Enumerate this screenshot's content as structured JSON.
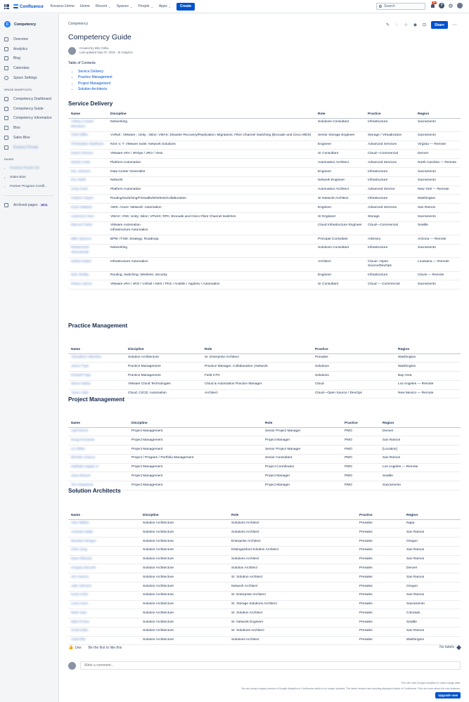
{
  "topnav": {
    "product": "Confluence",
    "items": [
      "Kovarus Home",
      "Home",
      "Recent",
      "Spaces",
      "People",
      "Apps"
    ],
    "dropdown_items": [
      "Recent",
      "Spaces",
      "People",
      "Apps"
    ],
    "create_label": "Create",
    "search_placeholder": "Search",
    "notifications_count": "9+"
  },
  "sidebar": {
    "space_name": "Competency",
    "nav": [
      "Overview",
      "Analytics",
      "Blog",
      "Calendars",
      "Space Settings"
    ],
    "shortcuts_heading": "SPACE SHORTCUTS",
    "shortcuts": [
      "Competency Dashboard",
      "Competency Guide",
      "Competency Information",
      "Bios",
      "Sales Bios",
      "Kovarus Private"
    ],
    "pages_heading": "PAGES",
    "pages": [
      "Kovarus Private Lib",
      "Sales Bios",
      "Partner Program Certifi..."
    ],
    "archived_label": "Archived pages",
    "beta_label": "BETA"
  },
  "page": {
    "breadcrumb": "Competency",
    "share_label": "Share",
    "title": "Competency Guide",
    "created_by": "Created by Milo Grilka",
    "last_updated": "Last updated May 07, 2019",
    "analytics_label": "Analytics",
    "toc_title": "Table of Contents",
    "toc": [
      "Service Delivery",
      "Practice Management",
      "Project Management",
      "Solution Architects"
    ]
  },
  "service_delivery": {
    "heading": "Service Delivery",
    "columns": [
      "Name",
      "Discipline",
      "Role",
      "Practice",
      "Region"
    ],
    "rows": [
      [
        "Ashley Conrad Mendoza",
        "Networking",
        "Solutions Consultant",
        "Infrastructure",
        "Sacramento"
      ],
      [
        "Chris Miller",
        "VxRail ; VMware ; Unity ; Isilon; VMAX; Disaster Recovery/Replication; Migrations; Fibre Channel Switching (Brocade and Cisco MDS)",
        "Senior Storage Engineer",
        "Storage / Virtualization",
        "Sacramento"
      ],
      [
        "Christopher Matthews",
        "NSX V, T: VMware Suite: Network Solutions",
        "Engineer",
        "Advanced Services",
        "Virginia — Remote"
      ],
      [
        "David Johnson",
        "VMware vRA / vROps / vRO / View",
        "Sr Consultant",
        "Cloud—Commercial",
        "Denver"
      ],
      [
        "Daniel Lewis",
        "Platform Automation",
        "Automation Architect",
        "Advanced Services",
        "North Carolina — Remote"
      ],
      [
        "Eric Johnson",
        "Data Center Generalist",
        "Engineer",
        "Infrastructure",
        "Sacramento"
      ],
      [
        "Eric Wells",
        "Network",
        "Network Engineer",
        "Infrastructure",
        "Sacramento"
      ],
      [
        "Greg Grant",
        "Platform Automation",
        "Automation Architect",
        "Advanced Service",
        "New York — Remote"
      ],
      [
        "Hudson Hayes",
        "Routing/Switching/Firewalls/Wireless/Collaboration",
        "Sr Network Architect",
        "Infrastructure",
        "Washington"
      ],
      [
        "Kevin Madsen",
        "AWS: Azure: Network: Automation",
        "Engineer",
        "Advanced Services",
        "San Ramon"
      ],
      [
        "Lawrence Hunt",
        "VMAX; VNX; Unity; Isilon; VPLEX; RPA; Brocade and Cisco Fibre Channel switches",
        "Sr Engineer",
        "Storage",
        "Sacramento"
      ],
      [
        "Marcus Foster",
        "VMware Automation\nInfrastructure Automation",
        "Cloud Infrastructure Engineer",
        "Cloud—Commercial",
        "Seattle"
      ],
      [
        "Mike Spencer",
        "BPM; ITSM; Strategy; Roadmap",
        "Principal Consultant",
        "Advisory",
        "Arizona — Remote"
      ],
      [
        "Mohammed Abouzeinab",
        "Networking",
        "Solutions Consultant",
        "Infrastructure",
        "Sacramento"
      ],
      [
        "Nathan Baker",
        "Infrastructure Automation",
        "Architect",
        "Cloud—Open Source/DevOps",
        "Louisiana — Remote"
      ],
      [
        "Nick Shelby",
        "Routing; Switching; Wireless; Security",
        "Engineer",
        "Infrastructure",
        "Clovis — Remote"
      ],
      [
        "Robert James",
        "VMware vRA / vRO / VxRail / AWS / PKS / Ansible / AppDev / Automation",
        "Sr Consultant",
        "Cloud — Commercial",
        "Sacramento"
      ]
    ]
  },
  "practice_management": {
    "heading": "Practice Management",
    "columns": [
      "Name",
      "Discipline",
      "Role",
      "Practice",
      "Region"
    ],
    "rows": [
      [
        "Johnathon Valentine",
        "Solution Architecture",
        "Sr. Enterprise Architect",
        "Presales",
        "Washington"
      ],
      [
        "Jason Pope",
        "Practice Management",
        "Practice Manager, Collaboration | Network",
        "Solutions",
        "Washington"
      ],
      [
        "Russell Fripp",
        "Practice Management",
        "Field CTO",
        "Solutions",
        "Bay Area"
      ],
      [
        "Steve Harlan",
        "VMware Cloud Technologies",
        "Cloud & Automation Practice Manager",
        "Cloud",
        "Los Angeles — Remote"
      ],
      [
        "Tyson Adair",
        "Cloud; CI/CD; Automation",
        "Architect",
        "Cloud—Open Source / DevOps",
        "New Mexico — Remote"
      ]
    ]
  },
  "project_management": {
    "heading": "Project Management",
    "columns": [
      "Name",
      "Discipline",
      "Role",
      "Practice",
      "Region"
    ],
    "rows": [
      [
        "April Morris",
        "Project Management",
        "Senior Project Manager",
        "PMO",
        "Denver"
      ],
      [
        "Doug Fernando",
        "Project Management",
        "Project Manager",
        "PMO",
        "San Ramon"
      ],
      [
        "Liz White",
        "Project Management",
        "Senior Project Manager",
        "PMO",
        "[Location]"
      ],
      [
        "Michele Chance",
        "Project / Program / Portfolio Management",
        "Senior Consultant",
        "PMO",
        "San Ramon"
      ],
      [
        "Nathalie Kappel Jr",
        "Project Management",
        "Project Coordinator",
        "PMO",
        "Los Angeles — Remote"
      ],
      [
        "Sara Weaver",
        "Project Management",
        "Project Manager",
        "PMO",
        "Seattle"
      ],
      [
        "Tim Kirkpatrick",
        "Project Management",
        "Project Manager",
        "PMO",
        "Sacramento"
      ]
    ]
  },
  "solution_architects": {
    "heading": "Solution Architects",
    "columns": [
      "Name",
      "Discipline",
      "Role",
      "Practice",
      "Region"
    ],
    "rows": [
      [
        "Alan Walton",
        "Solution Architecture",
        "Solutions Architect",
        "Presales",
        "Napa"
      ],
      [
        "Amanda Watts",
        "Solution Architecture",
        "Solutions Architect",
        "Presales",
        "San Ramon"
      ],
      [
        "Brandon Morgan",
        "Solution Architecture",
        "Enterprise Architect",
        "Presales",
        "Oregon"
      ],
      [
        "Chris Jeng",
        "Solution Architecture",
        "Distinguished Solution Architect",
        "Presales",
        "San Ramon"
      ],
      [
        "Dave Ellwood",
        "Solution Architecture",
        "Solutions Architect",
        "Presales",
        "San Ramon"
      ],
      [
        "Gregory Bennett",
        "Solution Architecture",
        "Solution Architect",
        "Presales",
        "Denver"
      ],
      [
        "Jim Hanson",
        "Solution Architecture",
        "Sr. Solution Architect",
        "Presales",
        "San Ramon"
      ],
      [
        "Julie Johnson",
        "Solution Architecture",
        "Network Architect",
        "Presales",
        "Oregon"
      ],
      [
        "Kevin Kohn",
        "Solution Architecture",
        "Sr. Enterprise Architect",
        "Presales",
        "San Ramon"
      ],
      [
        "Loren Ivers",
        "Solution Architecture",
        "Sr. Storage Solutions Architect",
        "Presales",
        "Sacramento"
      ],
      [
        "Mark Vass",
        "Solution Architecture",
        "Sr. Solution Architect",
        "Presales",
        "Colorado"
      ],
      [
        "Matt O'Hara",
        "Solution Architecture",
        "Sr. Network Engineer",
        "Presales",
        "Seattle"
      ],
      [
        "Scott Keller",
        "Solution Architecture",
        "Sr. Solutions Architect",
        "Presales",
        "San Ramon"
      ],
      [
        "Todd Ellis",
        "Solution Architecture",
        "Solutions Architect",
        "Presales",
        "Washington"
      ]
    ]
  },
  "footer": {
    "like_label": "Like",
    "like_text": "Be the first to like this",
    "no_labels": "No labels",
    "comment_placeholder": "Write a comment...",
    "ga_line1": "This site uses Google Analytics to collect usage data.",
    "ga_line2": "You are using a legacy version of Google Analytics in Confluence which is no longer updated. The latest version has reporting displayed inside of Confluence. Find out more about the new features.",
    "upgrade_label": "Upgrade now"
  }
}
